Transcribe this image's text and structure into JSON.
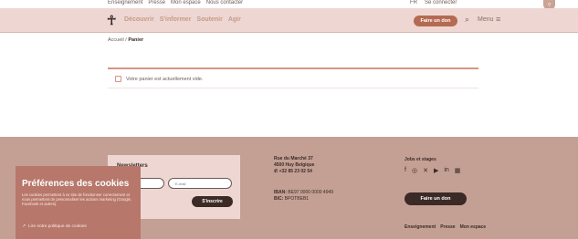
{
  "topbar": {
    "links": [
      "Enseignement",
      "Presse",
      "Mon espace",
      "Nous contacter"
    ],
    "lang": "FR",
    "login": "Se connecter"
  },
  "nav": {
    "items": [
      "Découvrir",
      "S'informer",
      "Soutenir",
      "Agir"
    ],
    "donate": "Faire un don",
    "menu": "Menu"
  },
  "breadcrumb": {
    "home": "Accueil",
    "sep": " / ",
    "current": "Panier"
  },
  "cart": {
    "empty_message": "Votre panier est actuellement vide."
  },
  "footer": {
    "newsletter": {
      "title": "Newsletters",
      "name_placeholder": "Nom",
      "email_placeholder": "E-mail",
      "submit": "S'inscrire"
    },
    "address": {
      "line1": "Rue du Marché 37",
      "line2": "4500 Huy Belgique",
      "phone": "+32 85 23 02 54"
    },
    "bank": {
      "iban_label": "IBAN:",
      "iban": "BE97 0000 0000 4949",
      "bic_label": "BIC:",
      "bic": "BPOTBEB1"
    },
    "jobs": "Jobs et stages",
    "donate": "Faire un don",
    "links": [
      "Enseignement",
      "Presse",
      "Mon espace"
    ]
  },
  "cookie": {
    "title": "Préférences des cookies",
    "text": "Les cookies permettent à ce site de fonctionner correctement et nous permettent de personnaliser les actions marketing (Google, Facebook et autres).",
    "link": "Lire notre politique de cookies"
  },
  "colors": {
    "nav_bg": "#eed7d2",
    "footer_bg": "#c4a094",
    "accent": "#b56a52",
    "dark": "#3b2a26",
    "cookie_bg": "#b7776a"
  }
}
